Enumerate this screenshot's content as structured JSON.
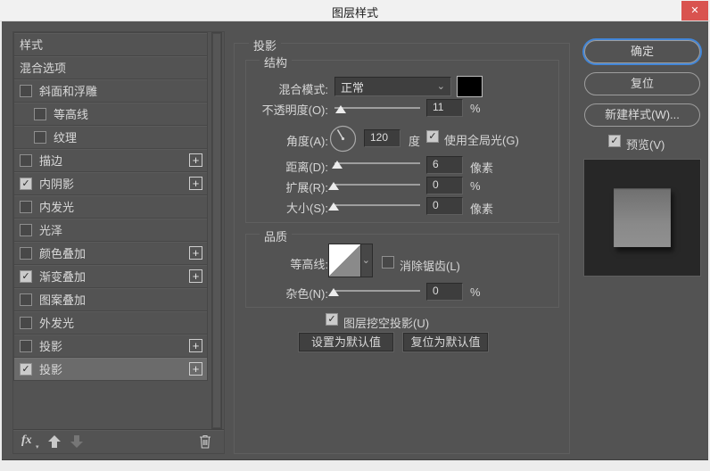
{
  "window": {
    "title": "图层样式"
  },
  "icons": {
    "close": "✕",
    "check": "✓",
    "plus": "+",
    "chevron": "⌄",
    "fx_caret": "▾",
    "fx": "fx"
  },
  "sidebar": {
    "items": [
      {
        "label": "样式",
        "checkbox": false,
        "checked": false,
        "indent": false,
        "plus": false,
        "selected": false
      },
      {
        "label": "混合选项",
        "checkbox": false,
        "checked": false,
        "indent": false,
        "plus": false,
        "selected": false
      },
      {
        "label": "斜面和浮雕",
        "checkbox": true,
        "checked": false,
        "indent": false,
        "plus": false,
        "selected": false
      },
      {
        "label": "等高线",
        "checkbox": true,
        "checked": false,
        "indent": true,
        "plus": false,
        "selected": false
      },
      {
        "label": "纹理",
        "checkbox": true,
        "checked": false,
        "indent": true,
        "plus": false,
        "selected": false
      },
      {
        "label": "描边",
        "checkbox": true,
        "checked": false,
        "indent": false,
        "plus": true,
        "selected": false
      },
      {
        "label": "内阴影",
        "checkbox": true,
        "checked": true,
        "indent": false,
        "plus": true,
        "selected": false
      },
      {
        "label": "内发光",
        "checkbox": true,
        "checked": false,
        "indent": false,
        "plus": false,
        "selected": false
      },
      {
        "label": "光泽",
        "checkbox": true,
        "checked": false,
        "indent": false,
        "plus": false,
        "selected": false
      },
      {
        "label": "颜色叠加",
        "checkbox": true,
        "checked": false,
        "indent": false,
        "plus": true,
        "selected": false
      },
      {
        "label": "渐变叠加",
        "checkbox": true,
        "checked": true,
        "indent": false,
        "plus": true,
        "selected": false
      },
      {
        "label": "图案叠加",
        "checkbox": true,
        "checked": false,
        "indent": false,
        "plus": false,
        "selected": false
      },
      {
        "label": "外发光",
        "checkbox": true,
        "checked": false,
        "indent": false,
        "plus": false,
        "selected": false
      },
      {
        "label": "投影",
        "checkbox": true,
        "checked": false,
        "indent": false,
        "plus": true,
        "selected": false
      },
      {
        "label": "投影",
        "checkbox": true,
        "checked": true,
        "indent": false,
        "plus": true,
        "selected": true
      }
    ],
    "toolbar": {
      "fx": "fx"
    }
  },
  "panel": {
    "title": "投影",
    "structure": {
      "legend": "结构",
      "blend_mode": {
        "label": "混合模式:",
        "value": "正常",
        "swatch_color": "#000000"
      },
      "opacity": {
        "label": "不透明度(O):",
        "value": "11",
        "unit": "%"
      },
      "angle": {
        "label": "角度(A):",
        "value": "120",
        "unit": "度",
        "global_light": "使用全局光(G)",
        "global_light_checked": true
      },
      "distance": {
        "label": "距离(D):",
        "value": "6",
        "unit": "像素"
      },
      "spread": {
        "label": "扩展(R):",
        "value": "0",
        "unit": "%"
      },
      "size": {
        "label": "大小(S):",
        "value": "0",
        "unit": "像素"
      }
    },
    "quality": {
      "legend": "品质",
      "contour": {
        "label": "等高线:",
        "antialias_label": "消除锯齿(L)",
        "antialias_checked": false
      },
      "noise": {
        "label": "杂色(N):",
        "value": "0",
        "unit": "%"
      }
    },
    "knockout": {
      "label": "图层挖空投影(U)",
      "checked": true
    },
    "buttons": {
      "set_default": "设置为默认值",
      "reset_default": "复位为默认值"
    }
  },
  "actions": {
    "ok": "确定",
    "reset": "复位",
    "new_style": "新建样式(W)...",
    "preview_label": "预览(V)",
    "preview_checked": true
  },
  "colors": {
    "accent_blue": "#4286d8",
    "close_red": "#d9534f",
    "shadow_color": "#000000"
  }
}
